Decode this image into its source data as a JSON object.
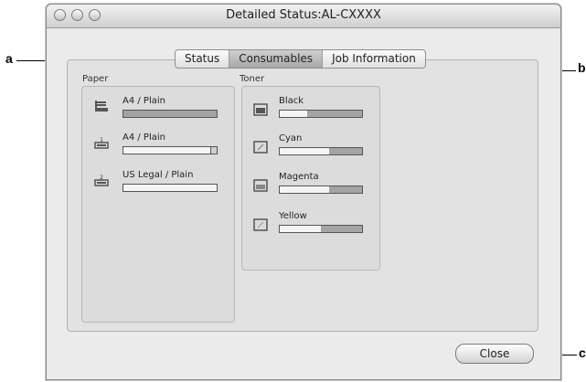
{
  "window": {
    "title": "Detailed Status:AL-CXXXX"
  },
  "tabs": [
    {
      "label": "Status"
    },
    {
      "label": "Consumables"
    },
    {
      "label": "Job Information"
    }
  ],
  "paper": {
    "group_label": "Paper",
    "trays": [
      {
        "label": "A4 / Plain",
        "icon": "tray-mp-icon",
        "level": 0.0
      },
      {
        "label": "A4 / Plain",
        "icon": "tray-1-icon",
        "tray_number": "1",
        "level": 0.95
      },
      {
        "label": "US Legal / Plain",
        "icon": "tray-2-icon",
        "tray_number": "2",
        "level": 1.0
      }
    ]
  },
  "toner": {
    "group_label": "Toner",
    "cartridges": [
      {
        "label": "Black",
        "icon": "toner-black-icon",
        "level": 0.33
      },
      {
        "label": "Cyan",
        "icon": "toner-cyan-icon",
        "level": 0.6
      },
      {
        "label": "Magenta",
        "icon": "toner-magenta-icon",
        "level": 0.6
      },
      {
        "label": "Yellow",
        "icon": "toner-yellow-icon",
        "level": 0.5
      }
    ]
  },
  "close_label": "Close",
  "callouts": {
    "a": "a",
    "b": "b",
    "c": "c"
  }
}
